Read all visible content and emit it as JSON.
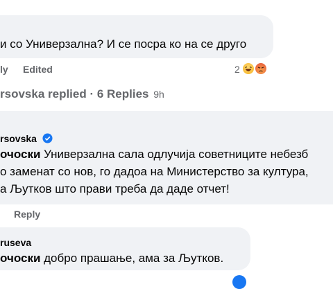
{
  "comment1": {
    "text": "и со Универзална? И се посра ко на се друго",
    "actions": {
      "reply": "ly",
      "edited": "Edited"
    },
    "reaction_count": "2",
    "reaction_icons": [
      "haha-emoji-icon",
      "angry-emoji-icon"
    ]
  },
  "replies_summary": {
    "text": "rsovska replied · 6 Replies",
    "time": "9h"
  },
  "reply1": {
    "author": "rsovska",
    "verified_icon": "verified-badge-icon",
    "tag": "очоски",
    "line1_rest": " Универзална сала одлучија советниците небезб",
    "line2": "о заменат со нов, го дадоа на Министерство за култура,",
    "line3": "а Љутков што прави треба да даде отчет!",
    "action_reply": "Reply"
  },
  "reply2": {
    "author": "ruseva",
    "tag": "очоски",
    "text_rest": " добро прашање, ама за Љутков."
  },
  "colors": {
    "bubble": "#f0f2f5",
    "meta": "#65676b",
    "verified": "#1877f2"
  }
}
